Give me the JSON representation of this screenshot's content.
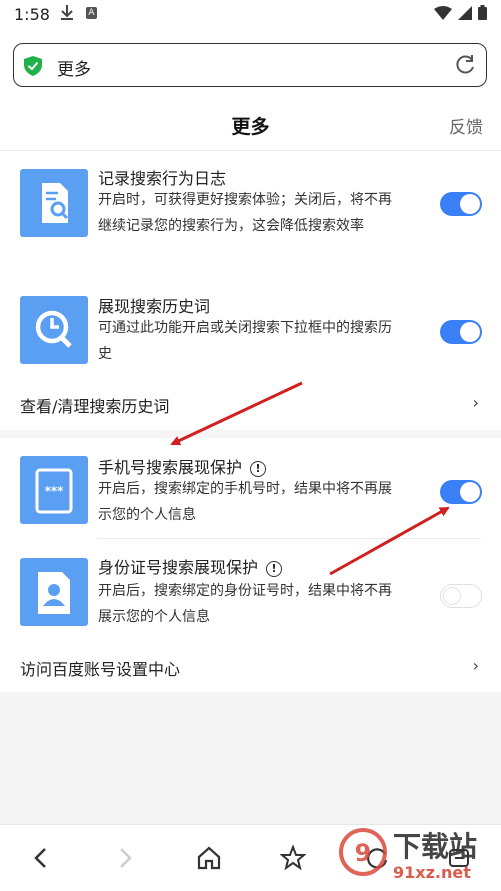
{
  "status_bar": {
    "time": "1:58",
    "a_label": "A"
  },
  "url_bar": {
    "text": "更多"
  },
  "header": {
    "title": "更多",
    "feedback": "反馈"
  },
  "items": [
    {
      "title": "记录搜索行为日志",
      "desc": "开启时，可获得更好搜索体验；关闭后，将不再继续记录您的搜索行为，这会降低搜索效率",
      "toggle": "on",
      "icon": "search-log-icon"
    },
    {
      "title": "展现搜索历史词",
      "desc": "可通过此功能开启或关闭搜索下拉框中的搜索历史",
      "toggle": "on",
      "icon": "history-clock-icon"
    },
    {
      "title": "手机号搜索展现保护",
      "desc": "开启后，搜索绑定的手机号时，结果中将不再展示您的个人信息",
      "toggle": "on",
      "icon": "phone-protect-icon"
    },
    {
      "title": "身份证号搜索展现保护",
      "desc": "开启后，搜索绑定的身份证号时，结果中将不再展示您的个人信息",
      "toggle": "off",
      "icon": "id-card-icon"
    }
  ],
  "links": {
    "history": "查看/清理搜索历史词",
    "account": "访问百度账号设置中心"
  },
  "phone_icon_text": "***",
  "watermark": {
    "text": "下载站",
    "url": "91xz.net"
  },
  "colors": {
    "accent": "#3a7ff5",
    "icon_bg": "#5b9ff2",
    "annotation_arrow": "#d02020"
  }
}
